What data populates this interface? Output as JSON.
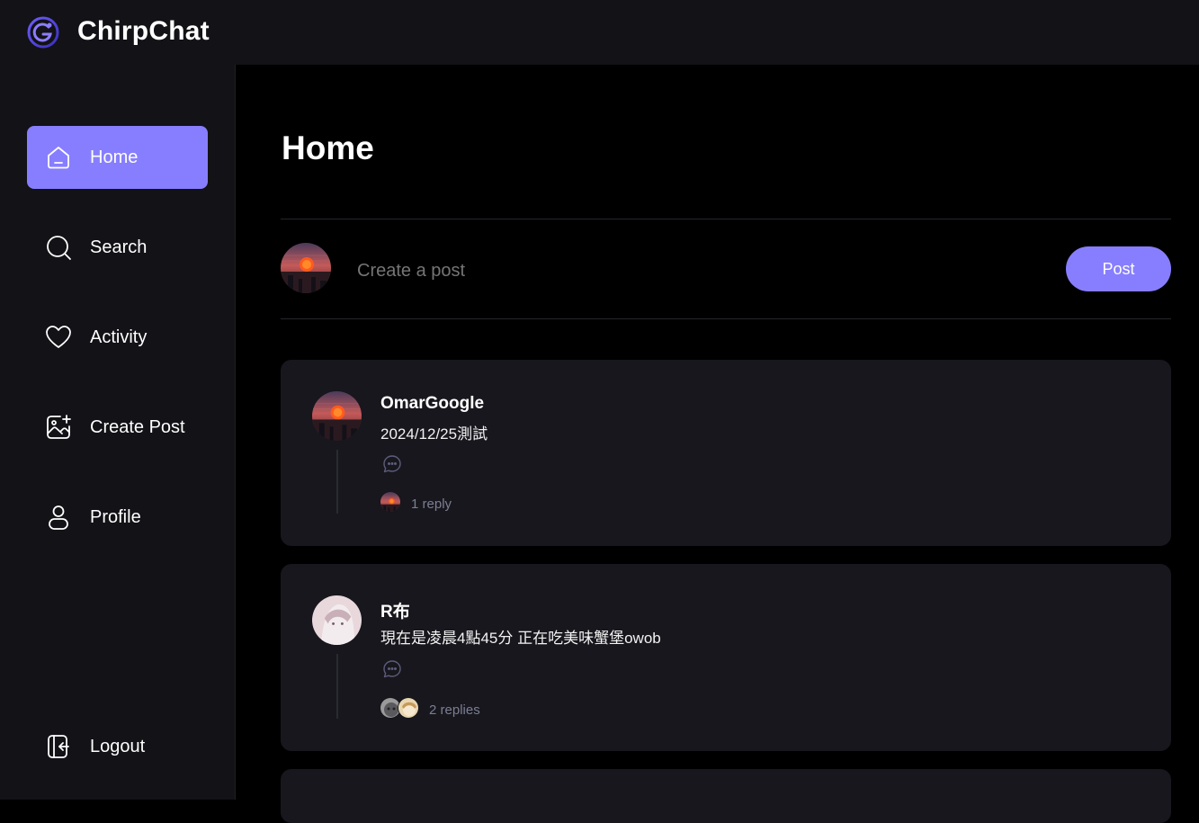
{
  "app": {
    "title": "ChirpChat",
    "accent": "#877eff"
  },
  "sidebar": {
    "items": [
      {
        "label": "Home",
        "icon": "home-icon",
        "active": true
      },
      {
        "label": "Search",
        "icon": "search-icon"
      },
      {
        "label": "Activity",
        "icon": "heart-icon"
      },
      {
        "label": "Create Post",
        "icon": "image-plus-icon"
      },
      {
        "label": "Profile",
        "icon": "user-icon"
      }
    ],
    "logout": {
      "label": "Logout",
      "icon": "logout-icon"
    }
  },
  "main": {
    "title": "Home",
    "composer": {
      "placeholder": "Create a post",
      "button": "Post"
    },
    "posts": [
      {
        "author": "OmarGoogle",
        "text": "2024/12/25測試",
        "replies": "1 reply"
      },
      {
        "author": "R布",
        "text": "現在是凌晨4點45分 正在吃美味蟹堡owob",
        "replies": "2 replies"
      }
    ]
  }
}
